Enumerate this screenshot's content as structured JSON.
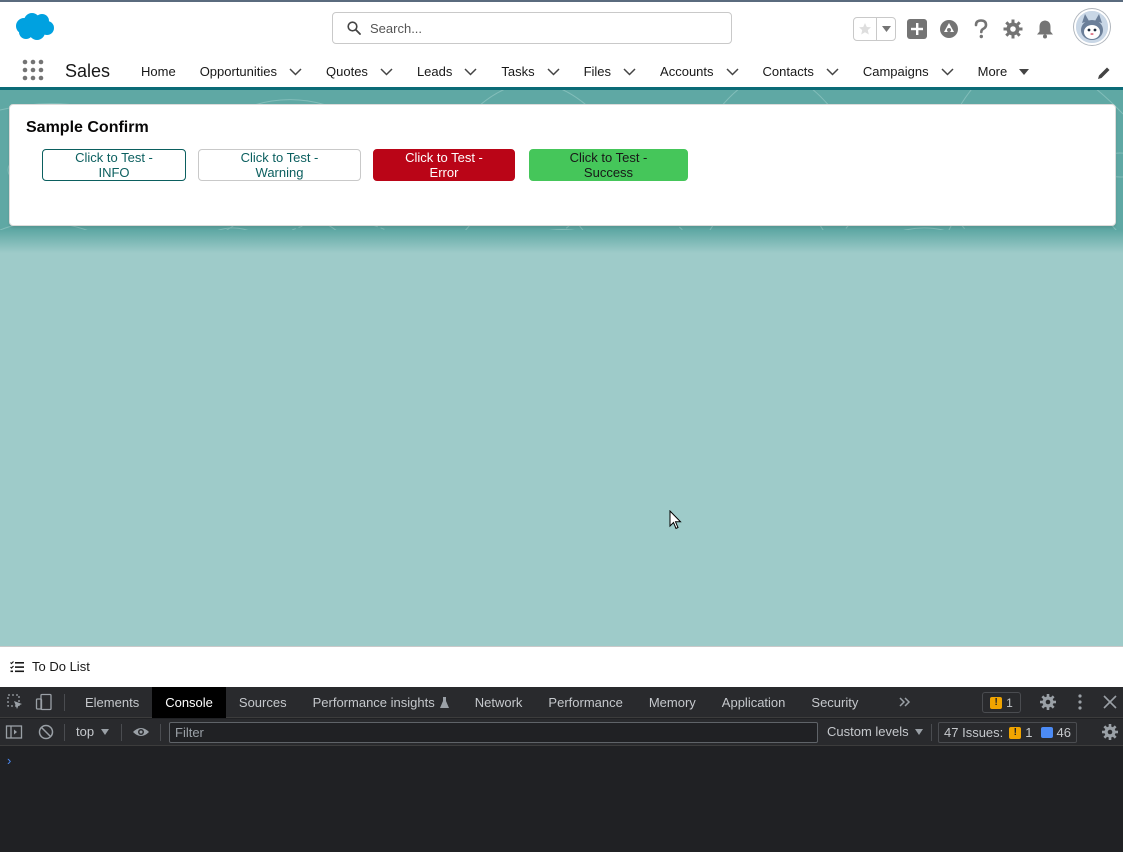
{
  "header": {
    "search_placeholder": "Search...",
    "icons": [
      "salesforce-logo",
      "star-icon",
      "chevron-down-icon",
      "add-icon",
      "trailhead-icon",
      "help-icon",
      "gear-icon",
      "bell-icon",
      "avatar"
    ]
  },
  "app_nav": {
    "app_name": "Sales",
    "items": [
      {
        "label": "Home",
        "has_menu": false
      },
      {
        "label": "Opportunities",
        "has_menu": true
      },
      {
        "label": "Quotes",
        "has_menu": true
      },
      {
        "label": "Leads",
        "has_menu": true
      },
      {
        "label": "Tasks",
        "has_menu": true
      },
      {
        "label": "Files",
        "has_menu": true
      },
      {
        "label": "Accounts",
        "has_menu": true
      },
      {
        "label": "Contacts",
        "has_menu": true
      },
      {
        "label": "Campaigns",
        "has_menu": true
      },
      {
        "label": "More",
        "has_menu": true
      }
    ]
  },
  "card": {
    "title": "Sample Confirm",
    "buttons": {
      "info": "Click to Test - INFO",
      "warning": "Click to Test - Warning",
      "error": "Click to Test - Error",
      "success": "Click to Test - Success"
    }
  },
  "utility_bar": {
    "item_label": "To Do List"
  },
  "devtools": {
    "tabs": [
      "Elements",
      "Console",
      "Sources",
      "Performance insights",
      "Network",
      "Performance",
      "Memory",
      "Application",
      "Security"
    ],
    "active_tab": "Console",
    "issue_badge": "1",
    "context": "top",
    "filter_placeholder": "Filter",
    "levels": "Custom levels",
    "issues_label": "47 Issues:",
    "issues_warnings": "1",
    "issues_messages": "46",
    "prompt": "›"
  },
  "colors": {
    "brand": "#00a1e0",
    "nav_accent": "#0b6b77",
    "error": "#ba0517",
    "success": "#45c65a",
    "content_bg": "#9ecbc9"
  }
}
